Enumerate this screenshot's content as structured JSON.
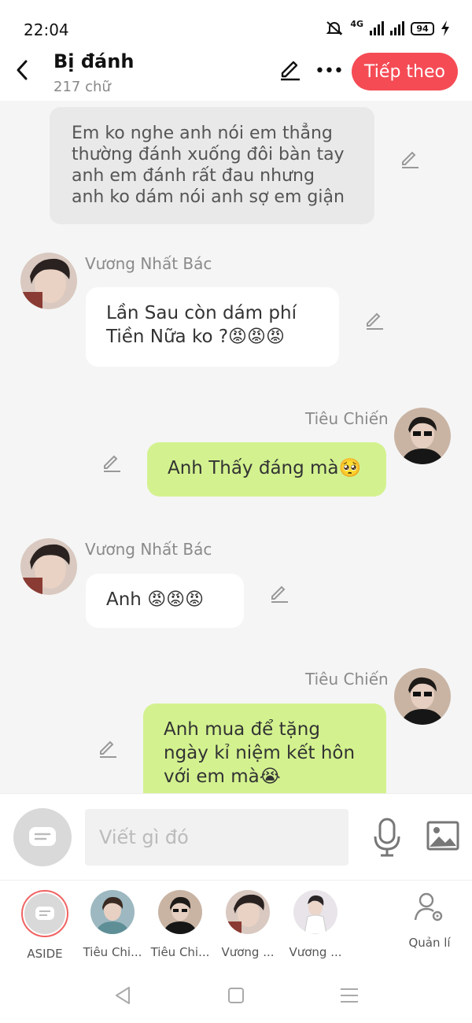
{
  "status": {
    "time": "22:04",
    "network": "4G",
    "battery": "94"
  },
  "header": {
    "title": "Bị đánh",
    "subtitle": "217 chữ",
    "next_label": "Tiếp theo"
  },
  "messages": {
    "narration": "Em ko nghe anh nói em thẳng thường đánh xuống đôi bàn tay anh em đánh rất đau nhưng anh ko dám nói anh sợ em giận",
    "m1": {
      "sender": "Vương Nhất Bác",
      "text": "Lần Sau còn dám phí Tiền Nữa ko ?😡😡😡"
    },
    "m2": {
      "sender": "Tiêu Chiến",
      "text": "Anh Thấy đáng mà🥺"
    },
    "m3": {
      "sender": "Vương Nhất Bác",
      "text": "Anh 😡😡😡"
    },
    "m4": {
      "sender": "Tiêu Chiến",
      "text": "Anh mua để tặng ngày kỉ niệm kết hôn với em mà😭"
    }
  },
  "input": {
    "placeholder": "Viết gì đó"
  },
  "characters": {
    "aside": "ASIDE",
    "c1": "Tiêu Chi...",
    "c2": "Tiêu Chi...",
    "c3": "Vương ...",
    "c4": "Vương ...",
    "manage": "Quản lí"
  },
  "colors": {
    "accent": "#f54b55",
    "bubble_right": "#d3f28f",
    "bubble_left": "#ffffff",
    "narration": "#e9e9e9"
  }
}
